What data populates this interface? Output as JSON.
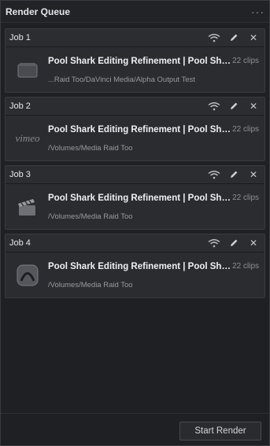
{
  "panel": {
    "title": "Render Queue",
    "more_icon": "more-dots-icon"
  },
  "jobs": [
    {
      "name": "Job 1",
      "title": "Pool Shark Editing Refinement | Pool Shark Editing Refinement",
      "clips": "22 clips",
      "path": "...Raid Too/DaVinci Media/Alpha Output Test",
      "thumb": "folder-icon"
    },
    {
      "name": "Job 2",
      "title": "Pool Shark Editing Refinement | Pool Shark Editing Refinement",
      "clips": "22 clips",
      "path": "/Volumes/Media Raid Too",
      "thumb": "vimeo-logo",
      "thumb_text": "vimeo"
    },
    {
      "name": "Job 3",
      "title": "Pool Shark Editing Refinement | Pool Shark Editing Refinement",
      "clips": "22 clips",
      "path": "/Volumes/Media Raid Too",
      "thumb": "clapperboard-icon"
    },
    {
      "name": "Job 4",
      "title": "Pool Shark Editing Refinement | Pool Shark Editing Refinement",
      "clips": "22 clips",
      "path": "/Volumes/Media Raid Too",
      "thumb": "avid-logo-icon"
    }
  ],
  "job_actions": [
    "remote-render-icon",
    "edit-pencil-icon",
    "close-icon"
  ],
  "footer": {
    "start_render_label": "Start Render"
  }
}
